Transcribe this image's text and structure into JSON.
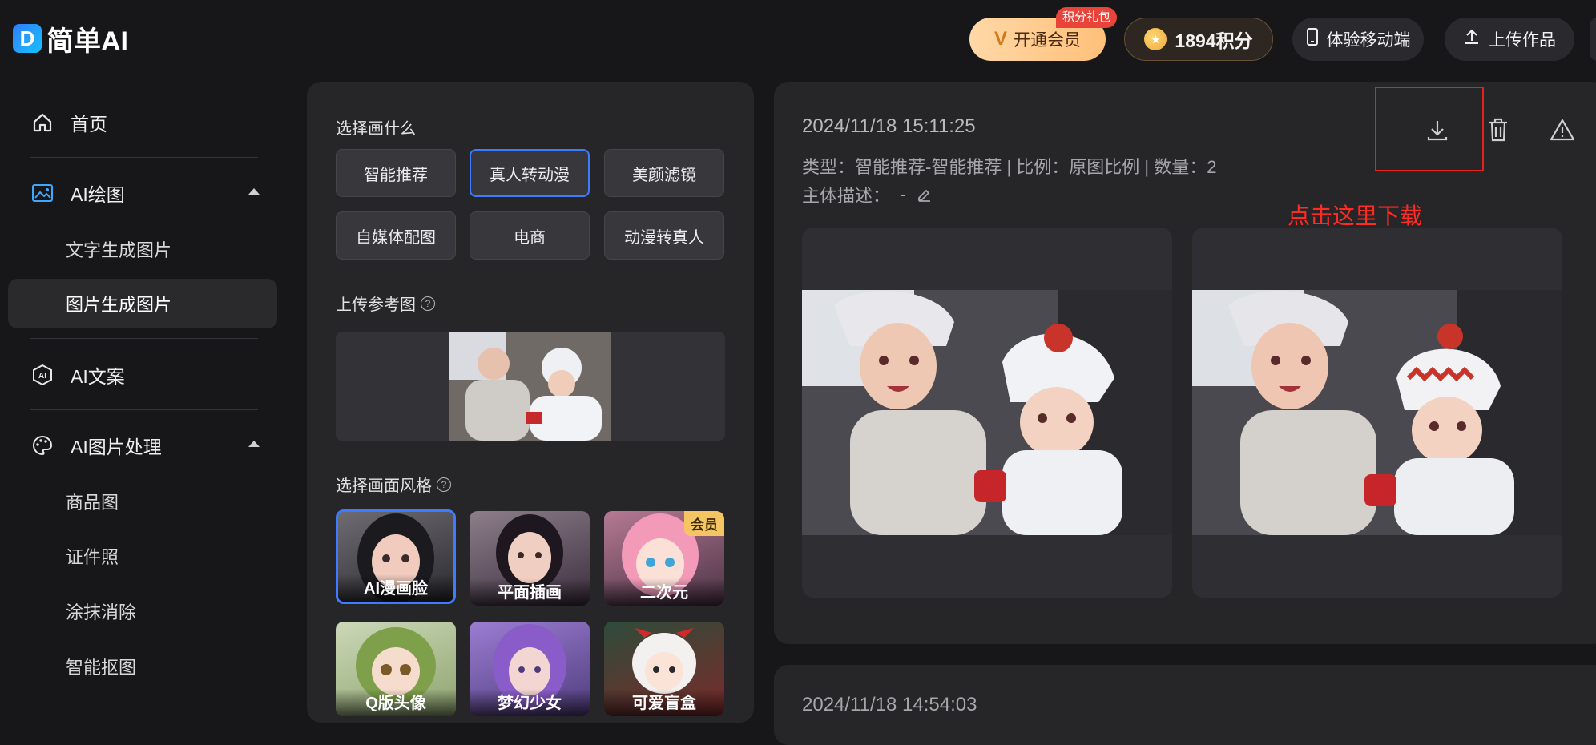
{
  "app": {
    "logo_mark": "D",
    "logo_text": "简单AI"
  },
  "header": {
    "vip_label": "开通会员",
    "gift_tag": "积分礼包",
    "points_label": "1894积分",
    "mobile_label": "体验移动端",
    "upload_label": "上传作品"
  },
  "sidebar": {
    "home": "首页",
    "ai_draw": "AI绘图",
    "ai_draw_sub": [
      "文字生成图片",
      "图片生成图片"
    ],
    "ai_copy": "AI文案",
    "ai_image": "AI图片处理",
    "ai_image_sub": [
      "商品图",
      "证件照",
      "涂抹消除",
      "智能抠图"
    ]
  },
  "mid": {
    "choose_title": "选择画什么",
    "chips": [
      "智能推荐",
      "真人转动漫",
      "美颜滤镜",
      "自媒体配图",
      "电商",
      "动漫转真人"
    ],
    "selected_chip": "真人转动漫",
    "upload_title": "上传参考图",
    "style_title": "选择画面风格",
    "styles": [
      {
        "label": "AI漫画脸",
        "vip": false
      },
      {
        "label": "平面插画",
        "vip": false
      },
      {
        "label": "二次元",
        "vip": true
      },
      {
        "label": "Q版头像",
        "vip": false
      },
      {
        "label": "梦幻少女",
        "vip": false
      },
      {
        "label": "可爱盲盒",
        "vip": false
      }
    ],
    "vip_badge": "会员"
  },
  "result": {
    "timestamp": "2024/11/18 15:11:25",
    "meta_line": "类型：智能推荐-智能推荐 | 比例：原图比例 | 数量：2",
    "desc_label": "主体描述：",
    "desc_value": "-",
    "note": "点击这里下载",
    "next_timestamp": "2024/11/18 14:54:03"
  },
  "icons": [
    "home-icon",
    "image-icon",
    "ai-copy-icon",
    "palette-icon",
    "download-icon",
    "trash-icon",
    "warning-icon",
    "edit-icon",
    "upload-icon",
    "phone-icon"
  ],
  "colors": {
    "accent": "#3f7bff",
    "annotation": "#e8201c",
    "vip": "#ffc07a"
  }
}
